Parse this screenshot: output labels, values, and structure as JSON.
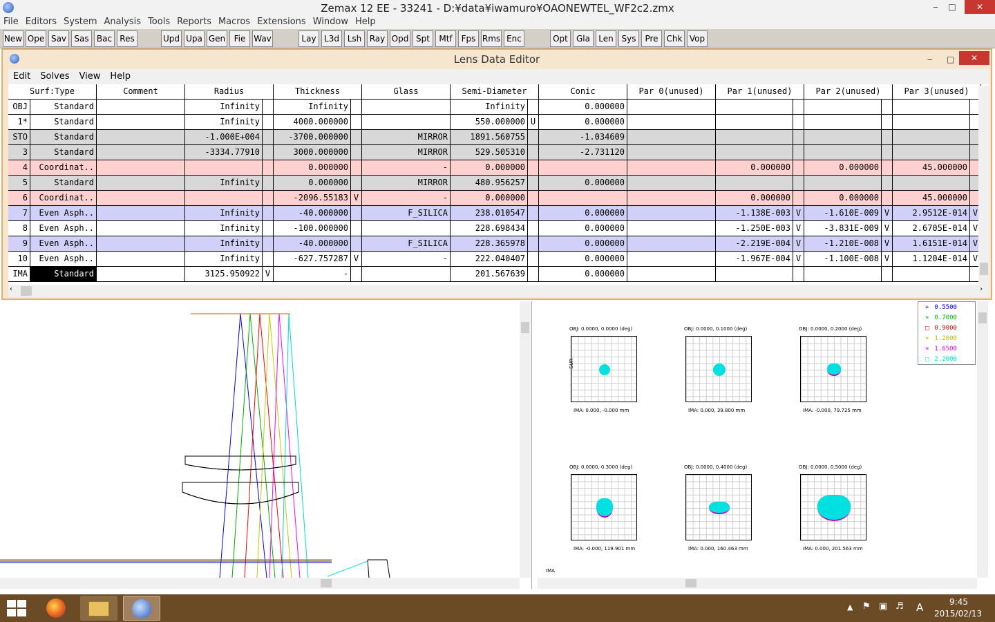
{
  "window": {
    "title": "Zemax 12 EE - 33241 - D:¥data¥iwamuro¥OAONEWTEL_WF2c2.zmx",
    "min": "‒",
    "max": "□",
    "close": "✕"
  },
  "menu": [
    "File",
    "Editors",
    "System",
    "Analysis",
    "Tools",
    "Reports",
    "Macros",
    "Extensions",
    "Window",
    "Help"
  ],
  "toolbar": [
    "New",
    "Ope",
    "Sav",
    "Sas",
    "Bac",
    "Res",
    "Upd",
    "Upa",
    "Gen",
    "Fie",
    "Wav",
    "Lay",
    "L3d",
    "Lsh",
    "Ray",
    "Opd",
    "Spt",
    "Mtf",
    "Fps",
    "Rms",
    "Enc",
    "Opt",
    "Gla",
    "Len",
    "Sys",
    "Pre",
    "Chk",
    "Vop"
  ],
  "lde": {
    "title": "Lens Data Editor",
    "menu": [
      "Edit",
      "Solves",
      "View",
      "Help"
    ],
    "headers": [
      "Surf:Type",
      "Comment",
      "Radius",
      "Thickness",
      "Glass",
      "Semi-Diameter",
      "Conic",
      "Par 0(unused)",
      "Par 1(unused)",
      "Par 2(unused)",
      "Par 3(unused)"
    ],
    "rows": [
      {
        "surf": "OBJ",
        "type": "Standard",
        "comment": "",
        "radius": "Infinity",
        "rs": "",
        "thick": "Infinity",
        "ts": "",
        "glass": "",
        "semi": "Infinity",
        "ss": "",
        "conic": "0.000000",
        "p0": "",
        "p1": "",
        "p1s": "",
        "p2": "",
        "p2s": "",
        "p3": "",
        "p3s": "",
        "bg": "#ffffff"
      },
      {
        "surf": "1*",
        "type": "Standard",
        "comment": "",
        "radius": "Infinity",
        "rs": "",
        "thick": "4000.000000",
        "ts": "",
        "glass": "",
        "semi": "550.000000",
        "ss": "U",
        "conic": "0.000000",
        "p0": "",
        "p1": "",
        "p1s": "",
        "p2": "",
        "p2s": "",
        "p3": "",
        "p3s": "",
        "bg": "#ffffff"
      },
      {
        "surf": "STO",
        "type": "Standard",
        "comment": "",
        "radius": "-1.000E+004",
        "rs": "",
        "thick": "-3700.000000",
        "ts": "",
        "glass": "MIRROR",
        "semi": "1891.560755",
        "ss": "",
        "conic": "-1.034609",
        "p0": "",
        "p1": "",
        "p1s": "",
        "p2": "",
        "p2s": "",
        "p3": "",
        "p3s": "",
        "bg": "#d8d8d8"
      },
      {
        "surf": "3",
        "type": "Standard",
        "comment": "",
        "radius": "-3334.77910",
        "rs": "",
        "thick": "3000.000000",
        "ts": "",
        "glass": "MIRROR",
        "semi": "529.505310",
        "ss": "",
        "conic": "-2.731120",
        "p0": "",
        "p1": "",
        "p1s": "",
        "p2": "",
        "p2s": "",
        "p3": "",
        "p3s": "",
        "bg": "#d8d8d8"
      },
      {
        "surf": "4",
        "type": "Coordinat..",
        "comment": "",
        "radius": "",
        "rs": "",
        "thick": "0.000000",
        "ts": "",
        "glass": "-",
        "semi": "0.000000",
        "ss": "",
        "conic": "",
        "p0": "",
        "p1": "0.000000",
        "p1s": "",
        "p2": "0.000000",
        "p2s": "",
        "p3": "45.000000",
        "p3s": "",
        "bg": "#ffd0d0"
      },
      {
        "surf": "5",
        "type": "Standard",
        "comment": "",
        "radius": "Infinity",
        "rs": "",
        "thick": "0.000000",
        "ts": "",
        "glass": "MIRROR",
        "semi": "480.956257",
        "ss": "",
        "conic": "0.000000",
        "p0": "",
        "p1": "",
        "p1s": "",
        "p2": "",
        "p2s": "",
        "p3": "",
        "p3s": "",
        "bg": "#d8d8d8"
      },
      {
        "surf": "6",
        "type": "Coordinat..",
        "comment": "",
        "radius": "",
        "rs": "",
        "thick": "-2096.55183",
        "ts": "V",
        "glass": "-",
        "semi": "0.000000",
        "ss": "",
        "conic": "",
        "p0": "",
        "p1": "0.000000",
        "p1s": "",
        "p2": "0.000000",
        "p2s": "",
        "p3": "45.000000",
        "p3s": "",
        "bg": "#ffd0d0"
      },
      {
        "surf": "7",
        "type": "Even Asph..",
        "comment": "",
        "radius": "Infinity",
        "rs": "",
        "thick": "-40.000000",
        "ts": "",
        "glass": "F_SILICA",
        "semi": "238.010547",
        "ss": "",
        "conic": "0.000000",
        "p0": "",
        "p1": "-1.138E-003",
        "p1s": "V",
        "p2": "-1.610E-009",
        "p2s": "V",
        "p3": "2.9512E-014",
        "p3s": "V",
        "bg": "#d0d0f8"
      },
      {
        "surf": "8",
        "type": "Even Asph..",
        "comment": "",
        "radius": "Infinity",
        "rs": "",
        "thick": "-100.000000",
        "ts": "",
        "glass": "",
        "semi": "228.698434",
        "ss": "",
        "conic": "0.000000",
        "p0": "",
        "p1": "-1.250E-003",
        "p1s": "V",
        "p2": "-3.831E-009",
        "p2s": "V",
        "p3": "2.6705E-014",
        "p3s": "V",
        "bg": "#ffffff"
      },
      {
        "surf": "9",
        "type": "Even Asph..",
        "comment": "",
        "radius": "Infinity",
        "rs": "",
        "thick": "-40.000000",
        "ts": "",
        "glass": "F_SILICA",
        "semi": "228.365978",
        "ss": "",
        "conic": "0.000000",
        "p0": "",
        "p1": "-2.219E-004",
        "p1s": "V",
        "p2": "-1.210E-008",
        "p2s": "V",
        "p3": "1.6151E-014",
        "p3s": "V",
        "bg": "#d0d0f8"
      },
      {
        "surf": "10",
        "type": "Even Asph..",
        "comment": "",
        "radius": "Infinity",
        "rs": "",
        "thick": "-627.757287",
        "ts": "V",
        "glass": "-",
        "semi": "222.040407",
        "ss": "",
        "conic": "0.000000",
        "p0": "",
        "p1": "-1.967E-004",
        "p1s": "V",
        "p2": "-1.100E-008",
        "p2s": "V",
        "p3": "1.1204E-014",
        "p3s": "V",
        "bg": "#ffffff"
      },
      {
        "surf": "IMA",
        "type": "Standard",
        "comment": "",
        "radius": "3125.950922",
        "rs": "V",
        "thick": "-",
        "ts": "",
        "glass": "",
        "semi": "201.567639",
        "ss": "",
        "conic": "0.000000",
        "p0": "",
        "p1": "",
        "p1s": "",
        "p2": "",
        "p2s": "",
        "p3": "",
        "p3s": "",
        "bg": "#ffffff"
      }
    ]
  },
  "spot": {
    "legend": [
      {
        "label": "0.5500",
        "color": "#0000ff",
        "mark": "+"
      },
      {
        "label": "0.7000",
        "color": "#00c000",
        "mark": "×"
      },
      {
        "label": "0.9000",
        "color": "#ff0000",
        "mark": "□"
      },
      {
        "label": "1.2000",
        "color": "#c0c000",
        "mark": "×"
      },
      {
        "label": "1.6500",
        "color": "#ff00ff",
        "mark": "×"
      },
      {
        "label": "2.2000",
        "color": "#00e0e0",
        "mark": "□"
      }
    ],
    "fields": [
      {
        "obj": "OBJ: 0.0000, 0.0000 (deg)",
        "ima": "IMA: 0.000, -0.000 mm"
      },
      {
        "obj": "OBJ: 0.0000, 0.1000 (deg)",
        "ima": "IMA: 0.000, 39.800 mm"
      },
      {
        "obj": "OBJ: 0.0000, 0.2000 (deg)",
        "ima": "IMA: -0.000, 79.725 mm"
      },
      {
        "obj": "OBJ: 0.0000, 0.3000 (deg)",
        "ima": "IMA: -0.000, 119.901 mm"
      },
      {
        "obj": "OBJ: 0.0000, 0.4000 (deg)",
        "ima": "IMA: 0.000, 160.463 mm"
      },
      {
        "obj": "OBJ: 0.0000, 0.5000 (deg)",
        "ima": "IMA: 0.000, 201.563 mm"
      }
    ],
    "side_label": "SUR",
    "bottom_label": "IMA"
  },
  "taskbar": {
    "time": "9:45",
    "date": "2015/02/13",
    "ime": "A"
  }
}
